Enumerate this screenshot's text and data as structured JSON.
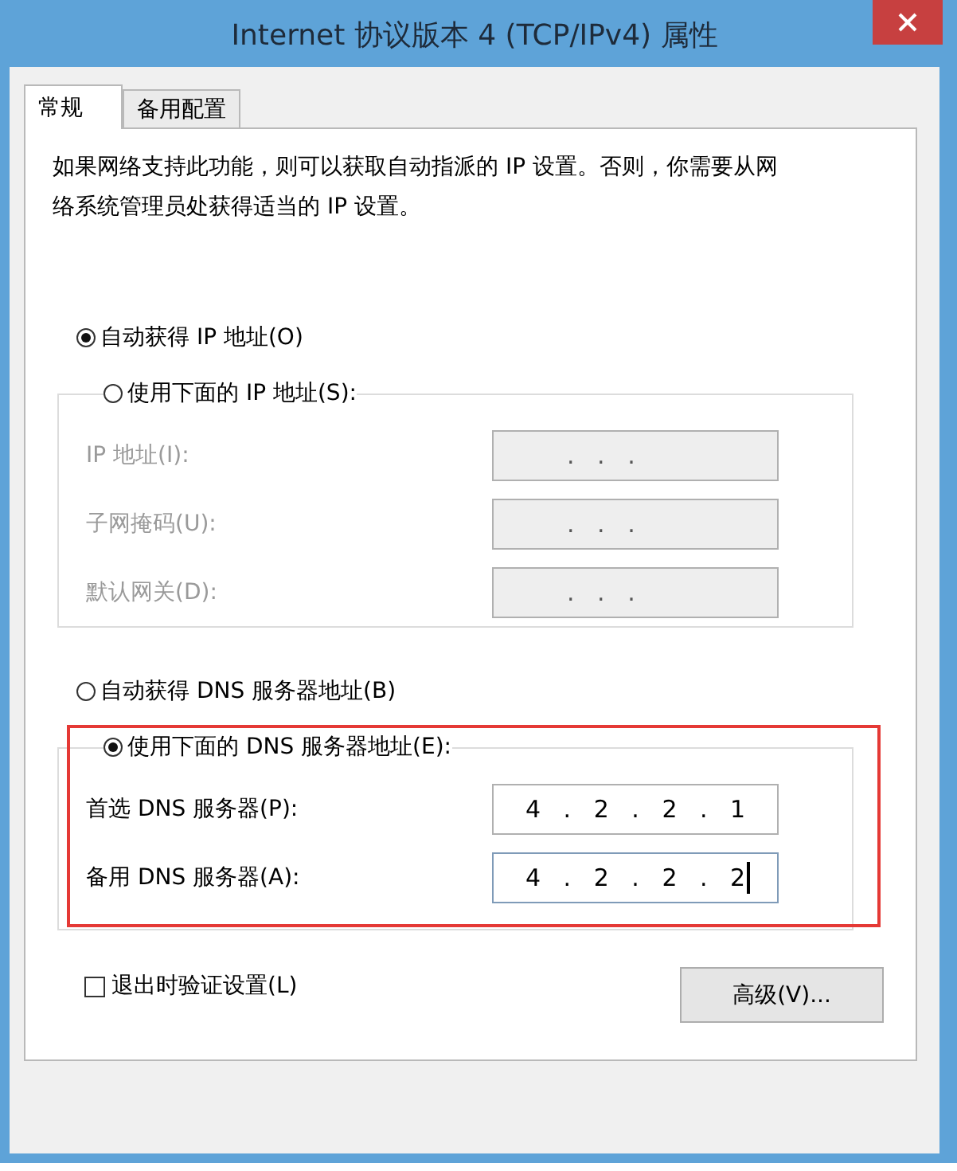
{
  "window": {
    "title": "Internet 协议版本 4 (TCP/IPv4) 属性"
  },
  "tabs": [
    {
      "label": "常规",
      "selected": true
    },
    {
      "label": "备用配置",
      "selected": false
    }
  ],
  "description": "如果网络支持此功能，则可以获取自动指派的 IP 设置。否则，你需要从网络系统管理员处获得适当的 IP 设置。",
  "ip_group": {
    "options": [
      {
        "label": "自动获得 IP 地址(O)",
        "selected": true
      },
      {
        "label": "使用下面的 IP 地址(S):",
        "selected": false
      }
    ],
    "fields": [
      {
        "label": "IP 地址(I):",
        "value": ". . .",
        "disabled": true,
        "focused": false
      },
      {
        "label": "子网掩码(U):",
        "value": ". . .",
        "disabled": true,
        "focused": false
      },
      {
        "label": "默认网关(D):",
        "value": ". . .",
        "disabled": true,
        "focused": false
      }
    ]
  },
  "dns_group": {
    "options": [
      {
        "label": "自动获得 DNS 服务器地址(B)",
        "selected": false
      },
      {
        "label": "使用下面的 DNS 服务器地址(E):",
        "selected": true
      }
    ],
    "fields": [
      {
        "label": "首选 DNS 服务器(P):",
        "value": "4 . 2 . 2 . 1",
        "disabled": false,
        "focused": false
      },
      {
        "label": "备用 DNS 服务器(A):",
        "value": "4 . 2 . 2 . 2",
        "disabled": false,
        "focused": true
      }
    ]
  },
  "annotation": {
    "kind": "rectangle"
  },
  "validate_on_exit": {
    "label": "退出时验证设置(L)",
    "checked": false
  },
  "advanced_button": "高级(V)..."
}
